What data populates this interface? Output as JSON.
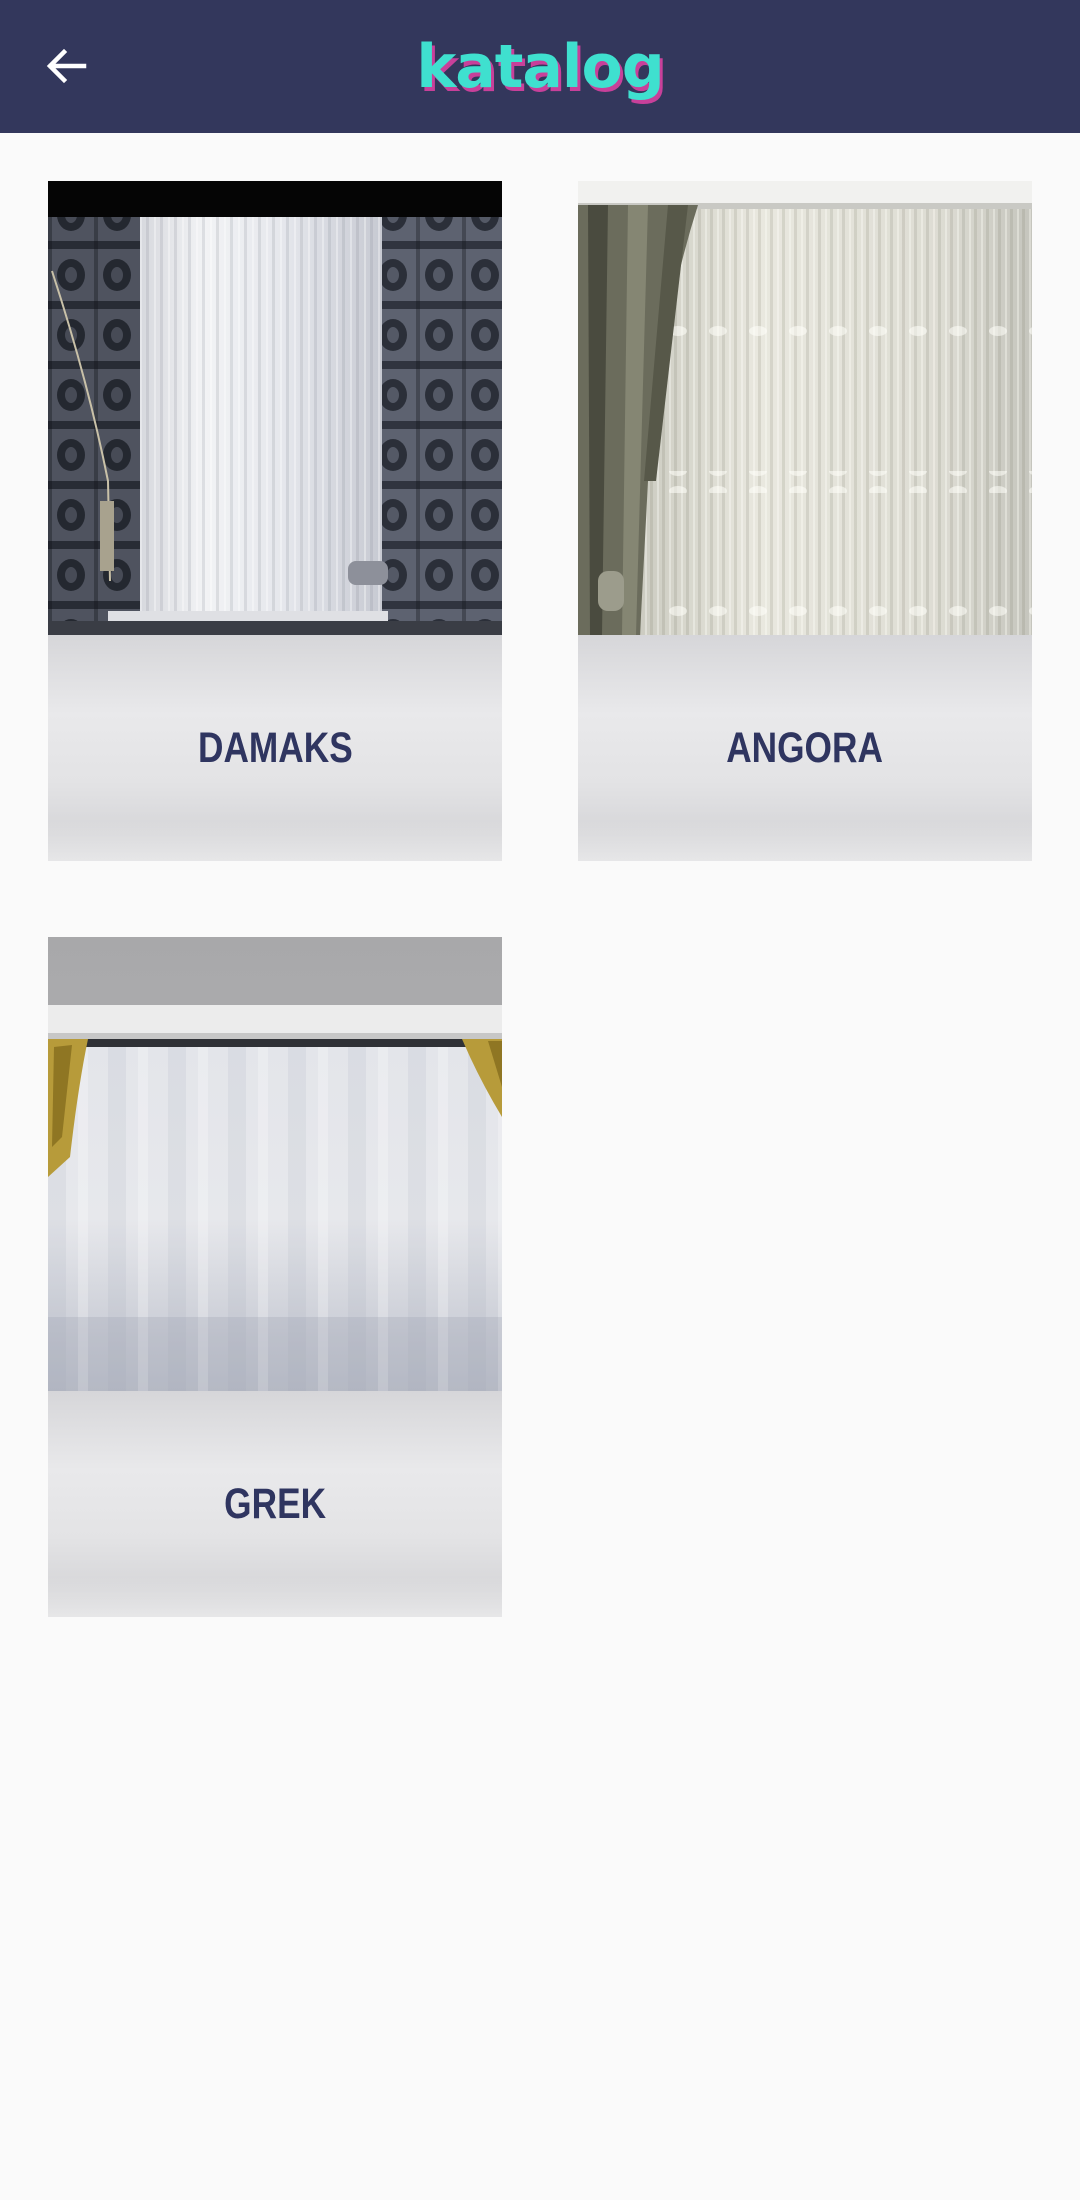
{
  "appbar": {
    "title": "katalog",
    "back_icon": "arrow-left-icon",
    "background": "#33375c",
    "title_color": "#3fe0cf",
    "title_shadow_color": "#c8409a"
  },
  "catalog": {
    "items": [
      {
        "label": "DAMAKS",
        "image": "curtain-photo"
      },
      {
        "label": "ANGORA",
        "image": "curtain-photo"
      },
      {
        "label": "GREK",
        "image": "curtain-photo"
      }
    ],
    "label_color": "#2f3560"
  }
}
